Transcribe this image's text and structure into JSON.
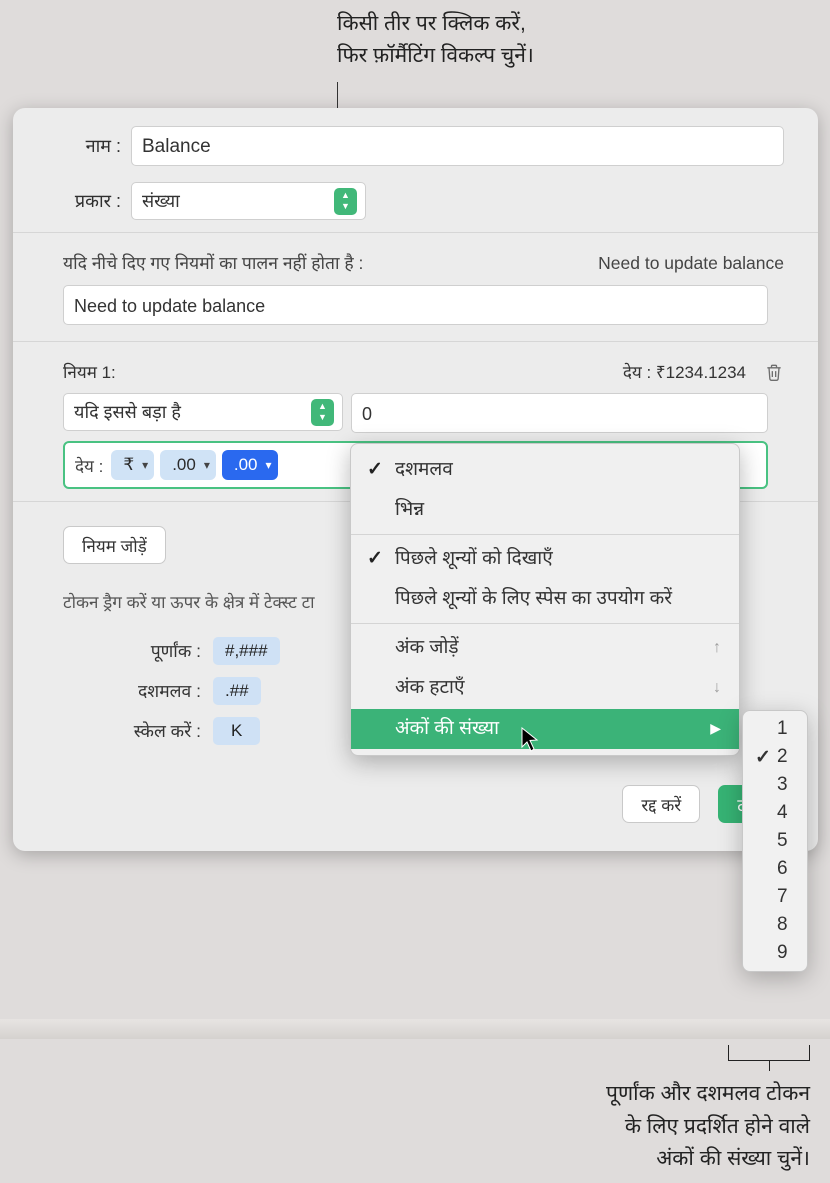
{
  "annotations": {
    "top_line1": "किसी तीर पर क्लिक करें,",
    "top_line2": "फिर फ़ॉर्मैटिंग विकल्प चुनें।",
    "bottom_line1": "पूर्णांक और दशमलव टोकन",
    "bottom_line2": "के लिए प्रदर्शित होने वाले",
    "bottom_line3": "अंकों की संख्या चुनें।"
  },
  "form": {
    "name_label": "नाम :",
    "name_value": "Balance",
    "kind_label": "प्रकार :",
    "kind_value": "संख्या",
    "rules_fail_label": "यदि नीचे दिए गए नियमों का पालन नहीं होता है :",
    "rules_fail_preview": "Need to update balance",
    "rules_fail_value": "Need to update balance",
    "rule1_label": "नियम 1:",
    "rule1_preview": "देय : ₹1234.1234",
    "rule1_cond": "यदि इससे बड़ा है",
    "rule1_value": "0",
    "token_row_label": "देय :",
    "tokens": {
      "t1": "₹",
      "t2": ".00",
      "t3": ".00"
    },
    "add_rule": "नियम जोड़ें",
    "drag_hint": "टोकन ड्रैग करें या ऊपर के क्षेत्र में टेक्स्ट टा",
    "int_label": "पूर्णांक :",
    "int_token": "#,###",
    "dec_label": "दशमलव :",
    "dec_token": ".##",
    "scale_label": "स्केल करें :",
    "scale_token": "K",
    "cancel": "रद्द करें",
    "ok": "ठीव"
  },
  "menu": {
    "decimal": "दशमलव",
    "fraction": "भिन्न",
    "show_zeros": "पिछले शून्यों को दिखाएँ",
    "space_zeros": "पिछले शून्यों के लिए स्पेस का उपयोग करें",
    "add_digit": "अंक जोड़ें",
    "remove_digit": "अंक हटाएँ",
    "digit_count": "अंकों की संख्या"
  },
  "submenu": {
    "items": [
      "1",
      "2",
      "3",
      "4",
      "5",
      "6",
      "7",
      "8",
      "9"
    ],
    "selected_index": 1
  }
}
